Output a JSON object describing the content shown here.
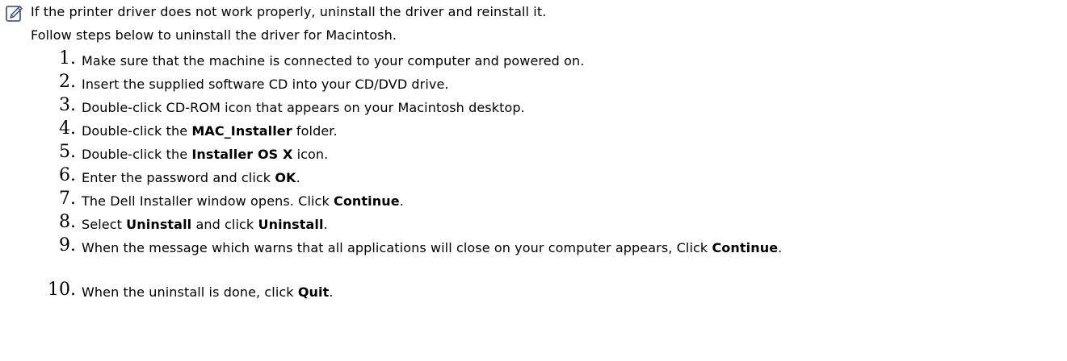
{
  "note": {
    "icon": "note-pencil-icon",
    "text": "If the printer driver does not work properly, uninstall the driver and reinstall it."
  },
  "intro": "Follow steps below to uninstall the driver for Macintosh.",
  "steps": [
    {
      "num": "1.",
      "pre": "Make sure that the machine is connected to your computer and powered on.",
      "b1": "",
      "mid": "",
      "b2": "",
      "post": ""
    },
    {
      "num": "2.",
      "pre": "Insert the supplied software CD into your CD/DVD drive.",
      "b1": "",
      "mid": "",
      "b2": "",
      "post": ""
    },
    {
      "num": "3.",
      "pre": "Double-click CD-ROM icon that appears on your Macintosh desktop.",
      "b1": "",
      "mid": "",
      "b2": "",
      "post": ""
    },
    {
      "num": "4.",
      "pre": "Double-click the ",
      "b1": "MAC_Installer",
      "mid": " folder.",
      "b2": "",
      "post": ""
    },
    {
      "num": "5.",
      "pre": "Double-click the ",
      "b1": "Installer OS X",
      "mid": " icon.",
      "b2": "",
      "post": ""
    },
    {
      "num": "6.",
      "pre": "Enter the password and click ",
      "b1": "OK",
      "mid": ".",
      "b2": "",
      "post": ""
    },
    {
      "num": "7.",
      "pre": "The Dell Installer window opens. Click ",
      "b1": "Continue",
      "mid": ".",
      "b2": "",
      "post": ""
    },
    {
      "num": "8.",
      "pre": "Select ",
      "b1": "Uninstall",
      "mid": " and click ",
      "b2": "Uninstall",
      "post": "."
    },
    {
      "num": "9.",
      "pre": "When the message which warns that all applications will close on your computer appears, Click ",
      "b1": "Continue",
      "mid": ".",
      "b2": "",
      "post": ""
    },
    {
      "num": "10.",
      "pre": "When the uninstall is done, click ",
      "b1": "Quit",
      "mid": ".",
      "b2": "",
      "post": ""
    }
  ]
}
